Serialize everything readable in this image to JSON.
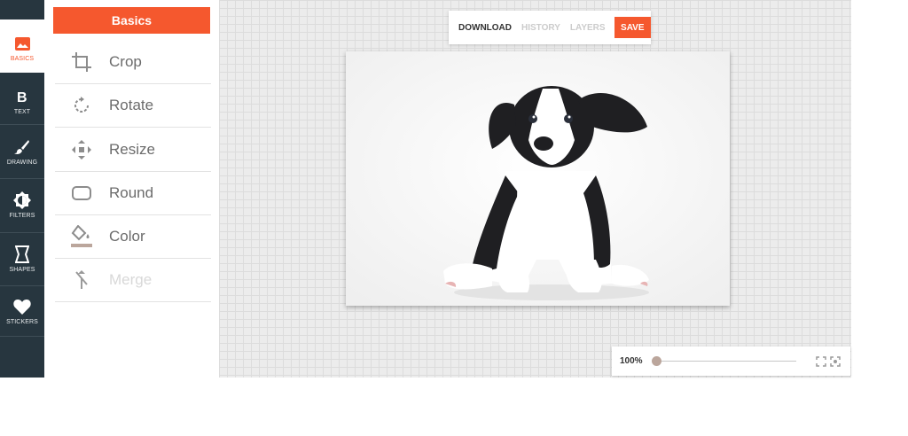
{
  "nav": {
    "items": [
      {
        "label": "BASICS",
        "icon": "image-icon"
      },
      {
        "label": "TEXT",
        "icon": "bold-text-icon"
      },
      {
        "label": "DRAWING",
        "icon": "brush-icon"
      },
      {
        "label": "FILTERS",
        "icon": "filter-icon"
      },
      {
        "label": "SHAPES",
        "icon": "shape-icon"
      },
      {
        "label": "STICKERS",
        "icon": "heart-icon"
      }
    ],
    "active": "BASICS"
  },
  "panel": {
    "title": "Basics",
    "tools": [
      {
        "label": "Crop",
        "icon": "crop-icon",
        "enabled": true
      },
      {
        "label": "Rotate",
        "icon": "rotate-icon",
        "enabled": true
      },
      {
        "label": "Resize",
        "icon": "resize-icon",
        "enabled": true
      },
      {
        "label": "Round",
        "icon": "round-corners-icon",
        "enabled": true
      },
      {
        "label": "Color",
        "icon": "fill-color-icon",
        "enabled": true
      },
      {
        "label": "Merge",
        "icon": "merge-icon",
        "enabled": false
      }
    ]
  },
  "toolbar": {
    "download_label": "DOWNLOAD",
    "history_label": "HISTORY",
    "layers_label": "LAYERS",
    "save_label": "SAVE"
  },
  "zoom": {
    "value_label": "100%",
    "level": 0
  },
  "colors": {
    "accent": "#f5582e",
    "nav_bg": "#27363f"
  }
}
